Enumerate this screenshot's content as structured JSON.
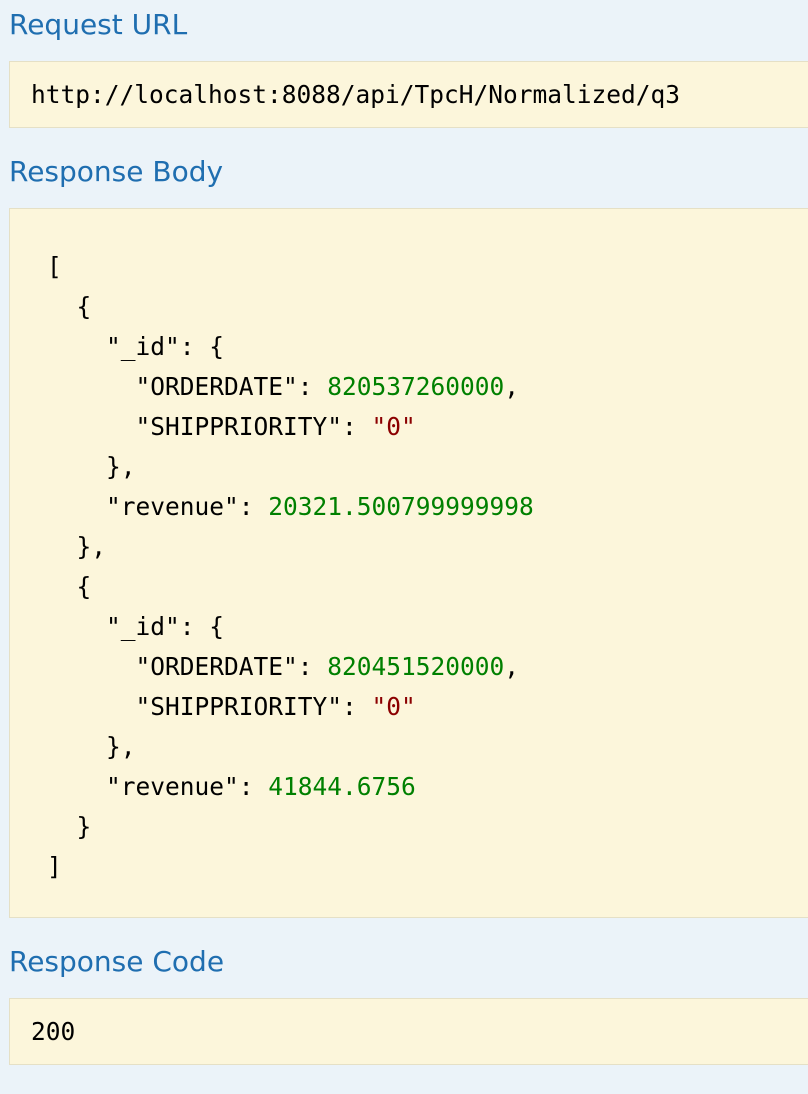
{
  "request_url": {
    "heading": "Request URL",
    "value": "http://localhost:8088/api/TpcH/Normalized/q3"
  },
  "response_body": {
    "heading": "Response Body",
    "lines": [
      [
        {
          "t": "["
        }
      ],
      [
        {
          "t": "  {"
        }
      ],
      [
        {
          "t": "    \"_id\": {"
        }
      ],
      [
        {
          "t": "      \"ORDERDATE\": "
        },
        {
          "t": "820537260000",
          "c": "num"
        },
        {
          "t": ","
        }
      ],
      [
        {
          "t": "      \"SHIPPRIORITY\": "
        },
        {
          "t": "\"0\"",
          "c": "str"
        }
      ],
      [
        {
          "t": "    },"
        }
      ],
      [
        {
          "t": "    \"revenue\": "
        },
        {
          "t": "20321.500799999998",
          "c": "num"
        }
      ],
      [
        {
          "t": "  },"
        }
      ],
      [
        {
          "t": "  {"
        }
      ],
      [
        {
          "t": "    \"_id\": {"
        }
      ],
      [
        {
          "t": "      \"ORDERDATE\": "
        },
        {
          "t": "820451520000",
          "c": "num"
        },
        {
          "t": ","
        }
      ],
      [
        {
          "t": "      \"SHIPPRIORITY\": "
        },
        {
          "t": "\"0\"",
          "c": "str"
        }
      ],
      [
        {
          "t": "    },"
        }
      ],
      [
        {
          "t": "    \"revenue\": "
        },
        {
          "t": "41844.6756",
          "c": "num"
        }
      ],
      [
        {
          "t": "  }"
        }
      ],
      [
        {
          "t": "]"
        }
      ]
    ]
  },
  "response_code": {
    "heading": "Response Code",
    "value": "200"
  },
  "colors": {
    "heading": "#1f6eb0",
    "page_background": "#ebf3f9",
    "box_background": "#fcf6db",
    "number": "#008000",
    "string": "#8b0000"
  }
}
